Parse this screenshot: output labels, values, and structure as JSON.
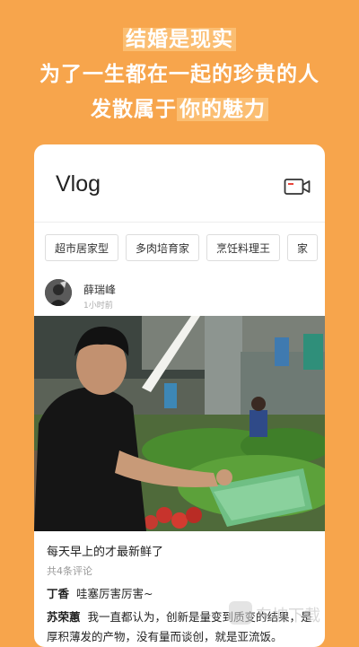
{
  "hero": {
    "line1": "结婚是现实",
    "line2": "为了一生都在一起的珍贵的人",
    "line3_prefix": "发散属于",
    "line3_highlight": "你的魅力"
  },
  "card": {
    "title": "Vlog",
    "tags": [
      "超市居家型",
      "多肉培育家",
      "烹饪料理王",
      "家"
    ],
    "post": {
      "author": "薛瑞峰",
      "time": "1小时前",
      "caption": "每天早上的才最新鲜了",
      "comment_count": "共4条评论",
      "comments": [
        {
          "name": "丁香",
          "text": "哇塞厉害厉害~"
        },
        {
          "name": "苏荣蕙",
          "text": "我一直都认为，创新是量变到质变的结果，是厚积薄发的产物，没有量而谈创，就是亚流饭。"
        }
      ]
    }
  },
  "watermark": {
    "text": "东坡下载"
  },
  "colors": {
    "background": "#F7A54C",
    "highlight": "#FBBE72"
  }
}
